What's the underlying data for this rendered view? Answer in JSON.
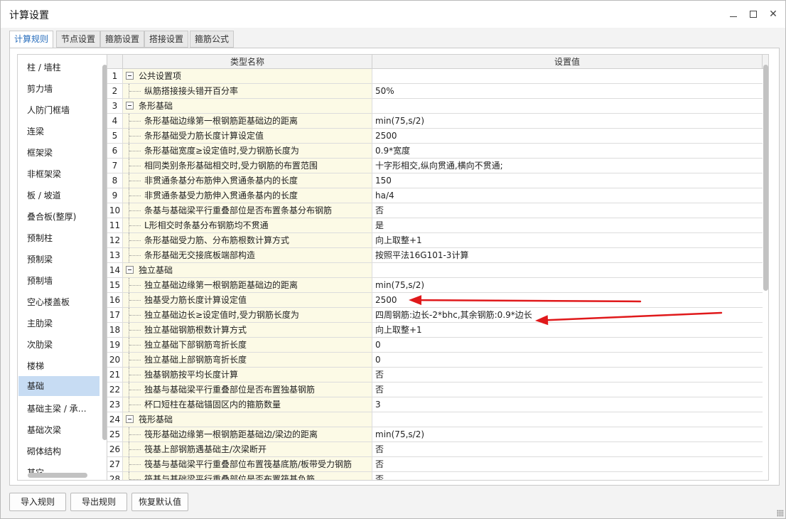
{
  "window": {
    "title": "计算设置",
    "minimize_icon": "minimize-icon",
    "maximize_icon": "maximize-icon",
    "close_icon": "close-icon",
    "close_glyph": "✕"
  },
  "tabs": [
    {
      "label": "计算规则",
      "active": true
    },
    {
      "label": "节点设置",
      "active": false
    },
    {
      "label": "箍筋设置",
      "active": false
    },
    {
      "label": "搭接设置",
      "active": false
    },
    {
      "label": "箍筋公式",
      "active": false
    }
  ],
  "left_list": {
    "selected": "基础",
    "items": [
      "柱 / 墙柱",
      "剪力墙",
      "人防门框墙",
      "连梁",
      "框架梁",
      "非框架梁",
      "板 / 坡道",
      "叠合板(整厚)",
      "预制柱",
      "预制梁",
      "预制墙",
      "空心楼盖板",
      "主肋梁",
      "次肋梁",
      "楼梯",
      "基础",
      "基础主梁 / 承…",
      "基础次梁",
      "砌体结构",
      "其它"
    ]
  },
  "grid": {
    "columns": {
      "name": "类型名称",
      "value": "设置值"
    },
    "rows": [
      {
        "num": "1",
        "name": "公共设置项",
        "value": "",
        "group": true
      },
      {
        "num": "2",
        "name": "纵筋搭接接头错开百分率",
        "value": "50%",
        "group": false
      },
      {
        "num": "3",
        "name": "条形基础",
        "value": "",
        "group": true
      },
      {
        "num": "4",
        "name": "条形基础边缘第一根钢筋距基础边的距离",
        "value": "min(75,s/2)",
        "group": false
      },
      {
        "num": "5",
        "name": "条形基础受力筋长度计算设定值",
        "value": "2500",
        "group": false
      },
      {
        "num": "6",
        "name": "条形基础宽度≥设定值时,受力钢筋长度为",
        "value": "0.9*宽度",
        "group": false
      },
      {
        "num": "7",
        "name": "相同类别条形基础相交时,受力钢筋的布置范围",
        "value": "十字形相交,纵向贯通,横向不贯通;",
        "group": false
      },
      {
        "num": "8",
        "name": "非贯通条基分布筋伸入贯通条基内的长度",
        "value": "150",
        "group": false
      },
      {
        "num": "9",
        "name": "非贯通条基受力筋伸入贯通条基内的长度",
        "value": "ha/4",
        "group": false
      },
      {
        "num": "10",
        "name": "条基与基础梁平行重叠部位是否布置条基分布钢筋",
        "value": "否",
        "group": false
      },
      {
        "num": "11",
        "name": "L形相交时条基分布钢筋均不贯通",
        "value": "是",
        "group": false
      },
      {
        "num": "12",
        "name": "条形基础受力筋、分布筋根数计算方式",
        "value": "向上取整+1",
        "group": false
      },
      {
        "num": "13",
        "name": "条形基础无交接底板端部构造",
        "value": "按照平法16G101-3计算",
        "group": false
      },
      {
        "num": "14",
        "name": "独立基础",
        "value": "",
        "group": true
      },
      {
        "num": "15",
        "name": "独立基础边缘第一根钢筋距基础边的距离",
        "value": "min(75,s/2)",
        "group": false
      },
      {
        "num": "16",
        "name": "独基受力筋长度计算设定值",
        "value": "2500",
        "group": false
      },
      {
        "num": "17",
        "name": "独立基础边长≥设定值时,受力钢筋长度为",
        "value": "四周钢筋:边长-2*bhc,其余钢筋:0.9*边长",
        "group": false
      },
      {
        "num": "18",
        "name": "独立基础钢筋根数计算方式",
        "value": "向上取整+1",
        "group": false
      },
      {
        "num": "19",
        "name": "独立基础下部钢筋弯折长度",
        "value": "0",
        "group": false
      },
      {
        "num": "20",
        "name": "独立基础上部钢筋弯折长度",
        "value": "0",
        "group": false
      },
      {
        "num": "21",
        "name": "独基钢筋按平均长度计算",
        "value": "否",
        "group": false
      },
      {
        "num": "22",
        "name": "独基与基础梁平行重叠部位是否布置独基钢筋",
        "value": "否",
        "group": false
      },
      {
        "num": "23",
        "name": "杯口短柱在基础锚固区内的箍筋数量",
        "value": "3",
        "group": false
      },
      {
        "num": "24",
        "name": "筏形基础",
        "value": "",
        "group": true
      },
      {
        "num": "25",
        "name": "筏形基础边缘第一根钢筋距基础边/梁边的距离",
        "value": "min(75,s/2)",
        "group": false
      },
      {
        "num": "26",
        "name": "筏基上部钢筋遇基础主/次梁断开",
        "value": "否",
        "group": false
      },
      {
        "num": "27",
        "name": "筏基与基础梁平行重叠部位布置筏基底筋/板带受力钢筋",
        "value": "否",
        "group": false
      },
      {
        "num": "28",
        "name": "筏基与基础梁平行重叠部位是否布置筏基负筋",
        "value": "否",
        "group": false
      }
    ]
  },
  "buttons": {
    "import": "导入规则",
    "export": "导出规则",
    "restore": "恢复默认值"
  },
  "annotation_color": "#e0191b"
}
